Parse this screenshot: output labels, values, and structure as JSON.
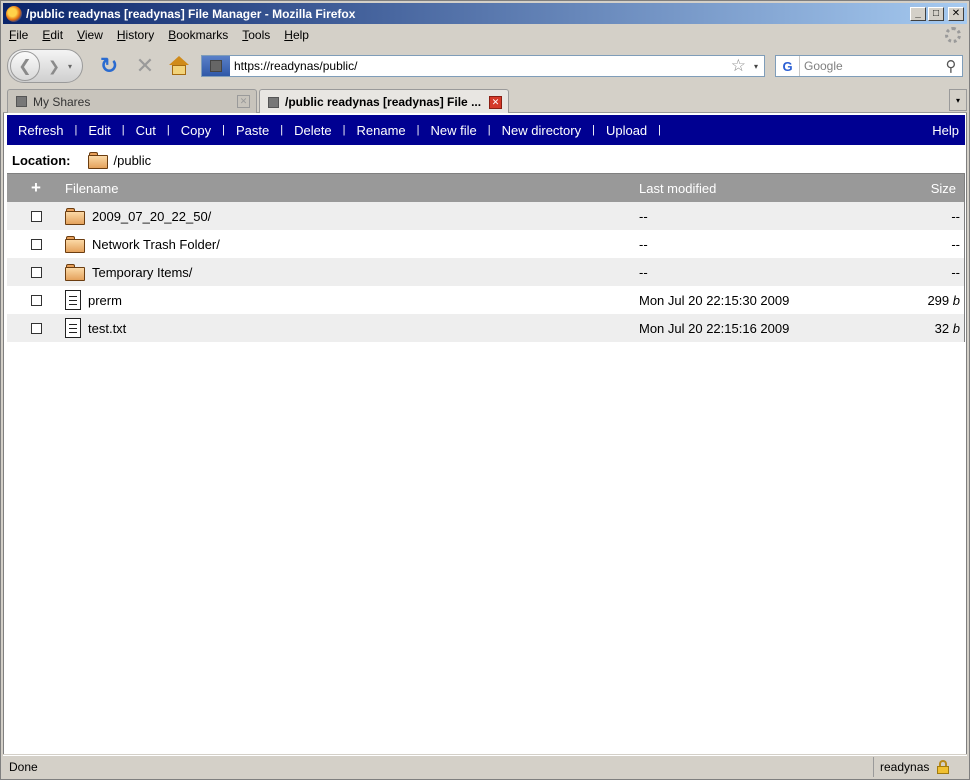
{
  "window": {
    "title": "/public readynas [readynas] File Manager - Mozilla Firefox",
    "minimize_label": "_",
    "maximize_label": "□",
    "close_label": "✕"
  },
  "menubar": {
    "items": [
      "File",
      "Edit",
      "View",
      "History",
      "Bookmarks",
      "Tools",
      "Help"
    ]
  },
  "navbar": {
    "back_glyph": "❮",
    "forward_glyph": "❯",
    "dropdown_glyph": "▾",
    "reload_glyph": "↻",
    "stop_glyph": "✕",
    "url": "https://readynas/public/",
    "star_glyph": "☆",
    "search_engine": "G",
    "search_placeholder": "Google",
    "search_glyph": "⚲"
  },
  "tabs": [
    {
      "label": "My Shares",
      "active": false
    },
    {
      "label": "/public readynas [readynas] File ...",
      "active": true
    }
  ],
  "tab_close_glyph": "✕",
  "tab_list_glyph": "▾",
  "file_manager": {
    "toolbar": [
      "Refresh",
      "Edit",
      "Cut",
      "Copy",
      "Paste",
      "Delete",
      "Rename",
      "New file",
      "New directory",
      "Upload"
    ],
    "separator": "|",
    "help": "Help",
    "location_label": "Location:",
    "location_path": "/public",
    "columns": {
      "add": "+",
      "filename": "Filename",
      "modified": "Last modified",
      "size": "Size"
    },
    "rows": [
      {
        "type": "folder",
        "name": "2009_07_20_22_50/",
        "modified": "--",
        "size": "--",
        "unit": ""
      },
      {
        "type": "folder",
        "name": "Network Trash Folder/",
        "modified": "--",
        "size": "--",
        "unit": ""
      },
      {
        "type": "folder",
        "name": "Temporary Items/",
        "modified": "--",
        "size": "--",
        "unit": ""
      },
      {
        "type": "file",
        "name": "prerm",
        "modified": "Mon Jul 20 22:15:30 2009",
        "size": "299",
        "unit": "b"
      },
      {
        "type": "file",
        "name": "test.txt",
        "modified": "Mon Jul 20 22:15:16 2009",
        "size": "32",
        "unit": "b"
      }
    ]
  },
  "statusbar": {
    "text": "Done",
    "host": "readynas"
  },
  "colors": {
    "toolbar_bg": "#000091",
    "header_bg": "#999999",
    "alt_row_bg": "#eeeeee"
  }
}
